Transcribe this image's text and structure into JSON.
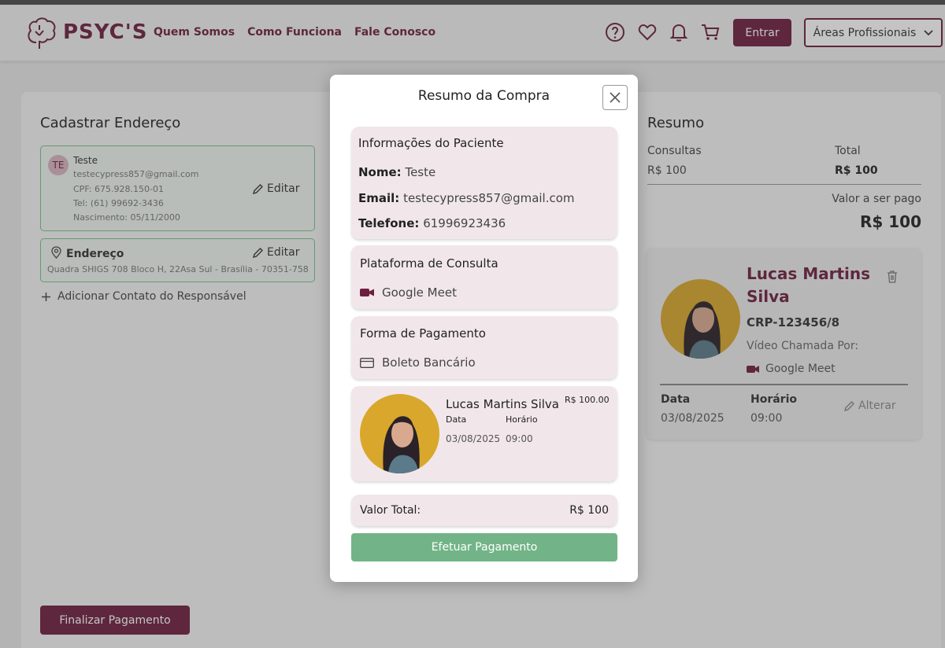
{
  "brand": {
    "name": "PSYC'S"
  },
  "nav": {
    "items": [
      "Quem Somos",
      "Como Funciona",
      "Fale Conosco"
    ]
  },
  "header": {
    "login_label": "Entrar",
    "areas_label": "Áreas Profissionais"
  },
  "address_section": {
    "title": "Cadastrar Endereço",
    "user": {
      "initials": "TE",
      "name": "Teste",
      "email": "testecypress857@gmail.com",
      "cpf": "CPF: 675.928.150-01",
      "phone": "Tel: (61) 99692-3436",
      "birth": "Nascimento: 05/11/2000"
    },
    "edit_label": "Editar",
    "address": {
      "title": "Endereço",
      "text": "Quadra SHIGS 708 Bloco H, 22Asa Sul - Brasília - 70351-758"
    },
    "add_contact_label": "Adicionar Contato do Responsável",
    "finalize_label": "Finalizar Pagamento"
  },
  "summary": {
    "title": "Resumo",
    "col_consultas": "Consultas",
    "col_total": "Total",
    "consultas_value": "R$ 100",
    "total_value": "R$ 100",
    "to_pay_label": "Valor a ser pago",
    "to_pay_value": "R$ 100",
    "psychologist": {
      "name": "Lucas Martins Silva",
      "crp": "CRP-123456/8",
      "via_label": "Vídeo Chamada Por:",
      "platform": "Google Meet",
      "date_label": "Data",
      "time_label": "Horário",
      "date": "03/08/2025",
      "time": "09:00",
      "change_label": "Alterar"
    }
  },
  "modal": {
    "title": "Resumo da Compra",
    "patient": {
      "title": "Informações do Paciente",
      "name_label": "Nome:",
      "name": "Teste",
      "email_label": "Email:",
      "email": "testecypress857@gmail.com",
      "phone_label": "Telefone:",
      "phone": "61996923436"
    },
    "platform": {
      "title": "Plataforma de Consulta",
      "value": "Google Meet"
    },
    "payment": {
      "title": "Forma de Pagamento",
      "value": "Boleto Bancário"
    },
    "item": {
      "name": "Lucas Martins Silva",
      "price": "R$ 100.00",
      "date_label": "Data",
      "time_label": "Horário",
      "date": "03/08/2025",
      "time": "09:00"
    },
    "total_label": "Valor Total:",
    "total_value": "R$ 100",
    "pay_label": "Efetuar Pagamento"
  },
  "colors": {
    "brand": "#6d1f3e",
    "success": "#72b487",
    "card_bg": "#f1e7ea"
  }
}
